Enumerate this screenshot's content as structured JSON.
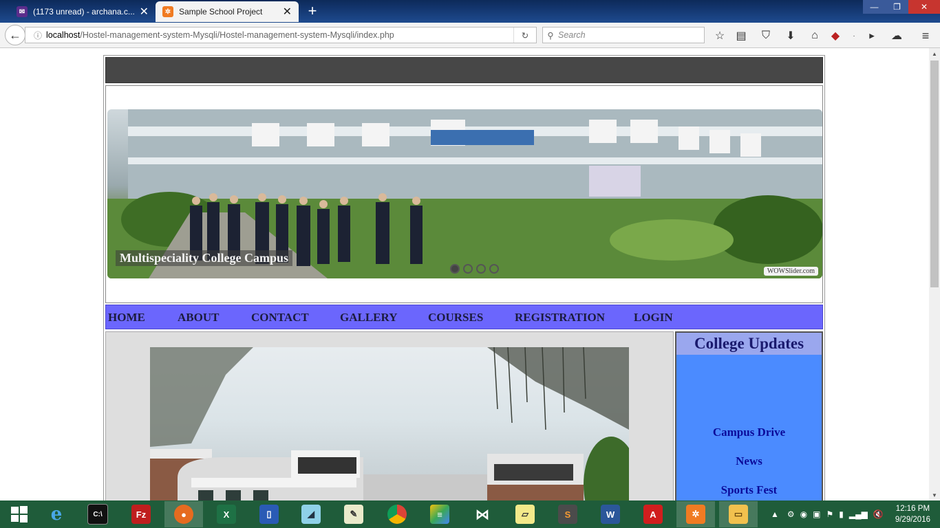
{
  "browser": {
    "tabs": [
      {
        "title": "(1173 unread) - archana.c...",
        "favicon": "mail-icon",
        "color": "#5b2d8c"
      },
      {
        "title": "Sample School Project",
        "favicon": "xampp-icon",
        "color": "#f07b22"
      }
    ],
    "url_host": "localhost",
    "url_path": "/Hostel-management-system-Mysqli/Hostel-management-system-Mysqli/index.php",
    "search_placeholder": "Search"
  },
  "page": {
    "slider": {
      "caption": "Multispeciality College Campus",
      "credit": "WOWSlider.com",
      "dot_count": 4,
      "active_dot": 1
    },
    "menu": [
      "HOME",
      "ABOUT",
      "CONTACT",
      "GALLERY",
      "COURSES",
      "REGISTRATION",
      "LOGIN"
    ],
    "updates": {
      "title": "College Updates",
      "items": [
        "Campus Drive",
        "News",
        "Sports Fest"
      ]
    }
  },
  "taskbar": {
    "apps": [
      "start-button",
      "internet-explorer-icon",
      "command-prompt-icon",
      "filezilla-icon",
      "firefox-icon",
      "excel-icon",
      "file-icon",
      "notes-icon",
      "notepad-icon",
      "chrome-icon",
      "bluestacks-icon",
      "visual-studio-icon",
      "sticky-notes-icon",
      "sublime-text-icon",
      "word-icon",
      "acrobat-icon",
      "xampp-icon",
      "file-explorer-icon"
    ],
    "time": "12:16 PM",
    "date": "9/29/2016"
  },
  "colors": {
    "menu_bar": "#6b66fd",
    "updates_panel": "#4b8bff",
    "updates_header": "#9aa7ee",
    "top_bar": "#474747",
    "taskbar": "#1f5c3a"
  }
}
